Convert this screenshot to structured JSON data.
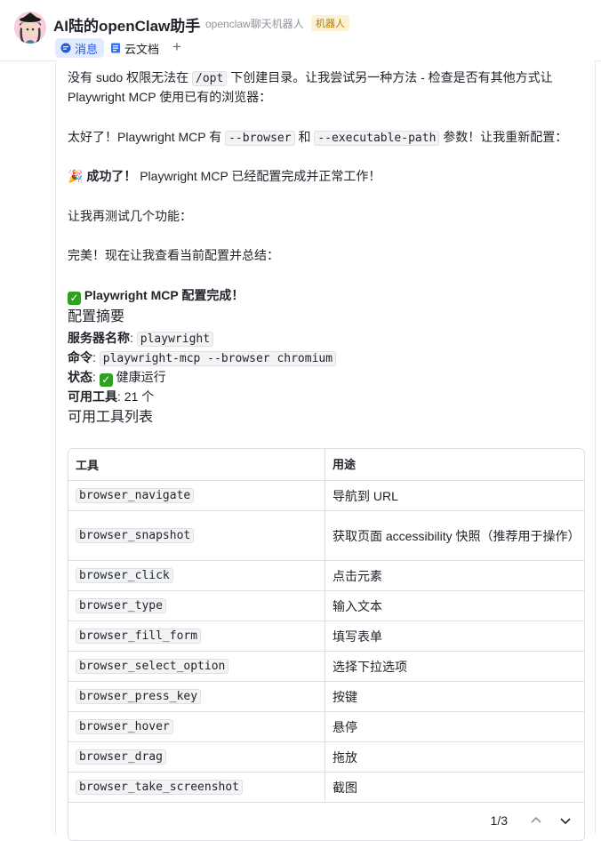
{
  "header": {
    "title": "AI陆的openClaw助手",
    "subtitle": "openclaw聊天机器人",
    "badge": "机器人",
    "tabs": [
      {
        "label": "消息",
        "icon": "chat-bubble-icon"
      },
      {
        "label": "云文档",
        "icon": "doc-icon"
      }
    ],
    "add_tab": "+"
  },
  "message": {
    "p1_a": "没有 sudo 权限无法在 ",
    "p1_code": "/opt",
    "p1_b": " 下创建目录。让我尝试另一种方法 - 检查是否有其他方式让",
    "p1_c": "Playwright MCP 使用已有的浏览器：",
    "p2_a": "太好了！Playwright MCP 有 ",
    "p2_code1": "--browser",
    "p2_b": " 和 ",
    "p2_code2": "--executable-path",
    "p2_c": " 参数！让我重新配置：",
    "p3_emoji": "🎉",
    "p3_bold": "成功了！",
    "p3_rest": " Playwright MCP 已经配置完成并正常工作！",
    "p4": "让我再测试几个功能：",
    "p5": "完美！现在让我查看当前配置并总结：",
    "heading1": "Playwright MCP 配置完成！",
    "heading2": "配置摘要",
    "server_label": "服务器名称",
    "server_value": "playwright",
    "cmd_label": "命令",
    "cmd_value": "playwright-mcp --browser chromium",
    "status_label": "状态",
    "status_value": "健康运行",
    "tools_label": "可用工具",
    "tools_value": "21 个",
    "heading3": "可用工具列表"
  },
  "table": {
    "headers": [
      "工具",
      "用途"
    ],
    "rows": [
      {
        "tool": "browser_navigate",
        "use": "导航到 URL"
      },
      {
        "tool": "browser_snapshot",
        "use": "获取页面 accessibility 快照（推荐用于操作）"
      },
      {
        "tool": "browser_click",
        "use": "点击元素"
      },
      {
        "tool": "browser_type",
        "use": "输入文本"
      },
      {
        "tool": "browser_fill_form",
        "use": "填写表单"
      },
      {
        "tool": "browser_select_option",
        "use": "选择下拉选项"
      },
      {
        "tool": "browser_press_key",
        "use": "按键"
      },
      {
        "tool": "browser_hover",
        "use": "悬停"
      },
      {
        "tool": "browser_drag",
        "use": "拖放"
      },
      {
        "tool": "browser_take_screenshot",
        "use": "截图"
      }
    ],
    "pager": "1/3"
  },
  "colors": {
    "accent": "#245bdb",
    "check": "#2ea121",
    "badge_bg": "#fdf3d4"
  }
}
